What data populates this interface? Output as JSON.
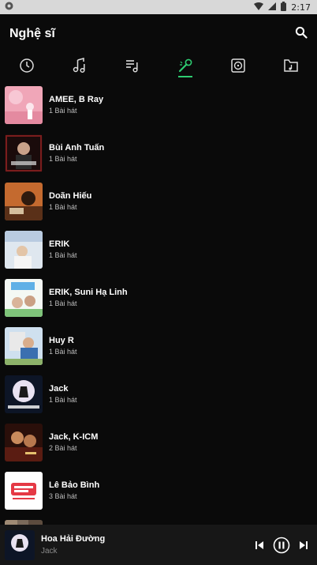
{
  "status": {
    "time": "2:17"
  },
  "header": {
    "title": "Nghệ sĩ"
  },
  "tabs": [
    {
      "icon": "history-icon"
    },
    {
      "icon": "music-notes-icon"
    },
    {
      "icon": "playlist-icon"
    },
    {
      "icon": "microphone-icon",
      "active": true
    },
    {
      "icon": "album-icon"
    },
    {
      "icon": "folder-music-icon"
    }
  ],
  "artists": [
    {
      "name": "AMEE, B Ray",
      "count": "1 Bài hát"
    },
    {
      "name": "Bùi Anh Tuấn",
      "count": "1 Bài hát"
    },
    {
      "name": "Doãn Hiếu",
      "count": "1 Bài hát"
    },
    {
      "name": "ERIK",
      "count": "1 Bài hát"
    },
    {
      "name": "ERIK, Suni Hạ Linh",
      "count": "1 Bài hát"
    },
    {
      "name": "Huy R",
      "count": "1 Bài hát"
    },
    {
      "name": "Jack",
      "count": "1 Bài hát"
    },
    {
      "name": "Jack, K-ICM",
      "count": "2 Bài hát"
    },
    {
      "name": "Lê Bảo Bình",
      "count": "3 Bài hát"
    }
  ],
  "now_playing": {
    "title": "Hoa Hải Đường",
    "artist": "Jack"
  },
  "colors": {
    "accent": "#2ecc71",
    "background": "#0a0a0a",
    "player_bg": "#171717"
  }
}
